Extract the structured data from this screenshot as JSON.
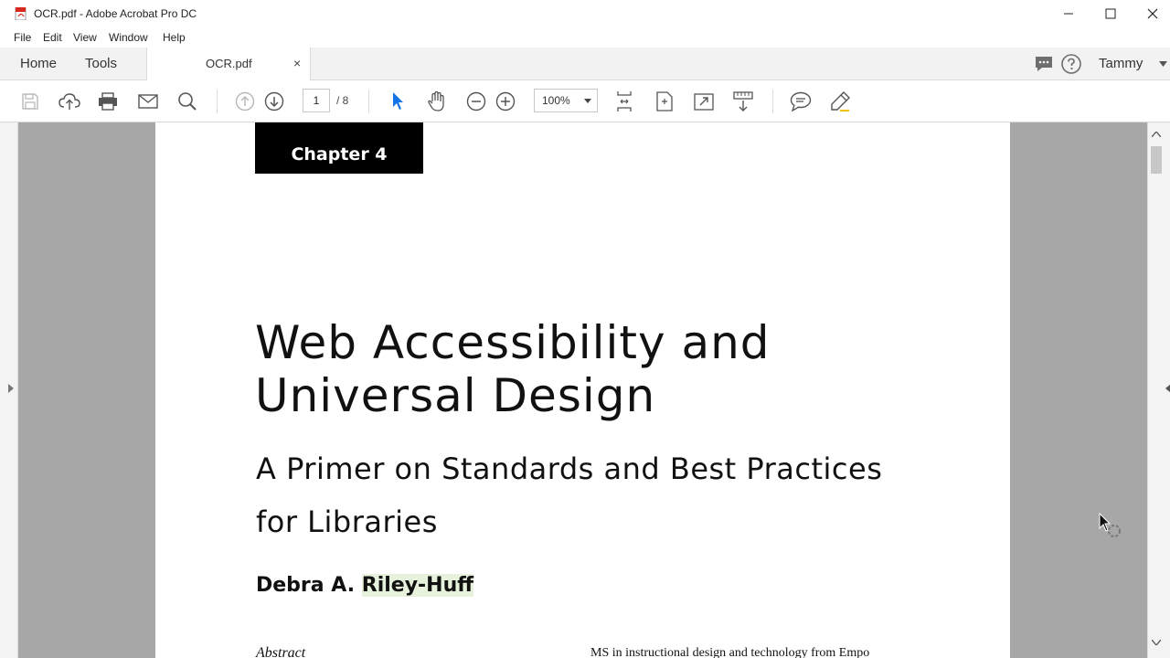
{
  "window": {
    "title": "OCR.pdf - Adobe Acrobat Pro DC",
    "icon": "acrobat-pdf-icon",
    "controls": {
      "minimize": "—",
      "maximize": "☐",
      "close": "✕"
    }
  },
  "menu": [
    "File",
    "Edit",
    "View",
    "Window",
    "Help"
  ],
  "tabs": {
    "home": "Home",
    "tools": "Tools",
    "document": "OCR.pdf",
    "document_close": "×",
    "user": "Tammy"
  },
  "toolbar": {
    "page_current": "1",
    "page_total": "/ 8",
    "zoom": "100%",
    "icons": [
      "save-icon",
      "upload-icon",
      "print-icon",
      "email-icon",
      "search-icon",
      "previous-page-icon",
      "next-page-icon",
      "select-cursor-icon",
      "hand-tool-icon",
      "zoom-out-icon",
      "zoom-in-icon",
      "fit-page-icon",
      "rotate-icon",
      "full-screen-icon",
      "scroll-mode-icon",
      "comment-icon",
      "highlight-pen-icon"
    ]
  },
  "document": {
    "chapter": "Chapter 4",
    "title_line1": "Web Accessibility and",
    "title_line2": "Universal Design",
    "subtitle_line1": "A Primer on Standards and Best Practices",
    "subtitle_line2": "for Libraries",
    "author_first": "Debra A.",
    "author_last": "Riley-Huff",
    "abstract_heading": "Abstract",
    "bio_partial": "MS in instructional design and technology from Empo"
  },
  "colors": {
    "accent_blue": "#1473e6",
    "viewer_background": "#a7a7a7",
    "chapter_box": "#000000"
  }
}
